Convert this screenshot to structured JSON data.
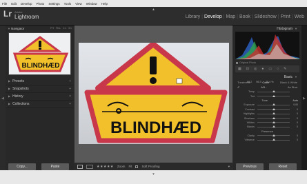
{
  "menu": [
    "File",
    "Edit",
    "Develop",
    "Photo",
    "Settings",
    "Tools",
    "View",
    "Window",
    "Help"
  ],
  "app": {
    "logo": "Lr",
    "adobe": "Adobe",
    "name": "Lightroom"
  },
  "modules": [
    "Library",
    "Develop",
    "Map",
    "Book",
    "Slideshow",
    "Print",
    "Web"
  ],
  "module_active": "Develop",
  "navigator": {
    "title": "Navigator",
    "options": [
      "FIT",
      "FILL",
      "1:1",
      "3:1"
    ]
  },
  "left_sections": [
    "Presets",
    "Snapshots",
    "History",
    "Collections"
  ],
  "left_buttons": {
    "copy": "Copy...",
    "paste": "Paste"
  },
  "filmstrip": {
    "zoom": "Zoom",
    "fit": "Fit",
    "soft_proofing": "Soft Proofing"
  },
  "sign_text": "BLINDHÆD",
  "histogram": {
    "title": "Histogram",
    "values": [
      "66.2",
      "56.3",
      "25.4 %"
    ]
  },
  "original_photo": "Original Photo",
  "basic": {
    "title": "Basic",
    "treatment": "Treatment :",
    "treat_options": [
      "Color",
      "Black & White"
    ],
    "treat_active": "Color",
    "wb_label": "WB :",
    "wb_value": "As Shot",
    "sliders1": [
      {
        "label": "Temp",
        "val": ""
      },
      {
        "label": "Tint",
        "val": ""
      }
    ],
    "tone": "Tone",
    "tone_auto": "Auto",
    "sliders2": [
      {
        "label": "Exposure",
        "val": "0.00",
        "pos": 0.5
      },
      {
        "label": "Contrast",
        "val": "0",
        "pos": 0.5
      },
      {
        "label": "Highlights",
        "val": "0",
        "pos": 0.5
      },
      {
        "label": "Shadows",
        "val": "0",
        "pos": 0.5
      },
      {
        "label": "Whites",
        "val": "0",
        "pos": 0.5
      },
      {
        "label": "Blacks",
        "val": "0",
        "pos": 0.5
      }
    ],
    "presence": "Presence",
    "sliders3": [
      {
        "label": "Clarity",
        "val": "0",
        "pos": 0.5
      },
      {
        "label": "Vibrance",
        "val": "0",
        "pos": 0.5
      }
    ]
  },
  "right_buttons": {
    "previous": "Previous",
    "reset": "Reset"
  },
  "colors": {
    "accent": "#f0f0f0",
    "sign_yellow": "#f2c02a",
    "sign_red": "#c8384a"
  }
}
